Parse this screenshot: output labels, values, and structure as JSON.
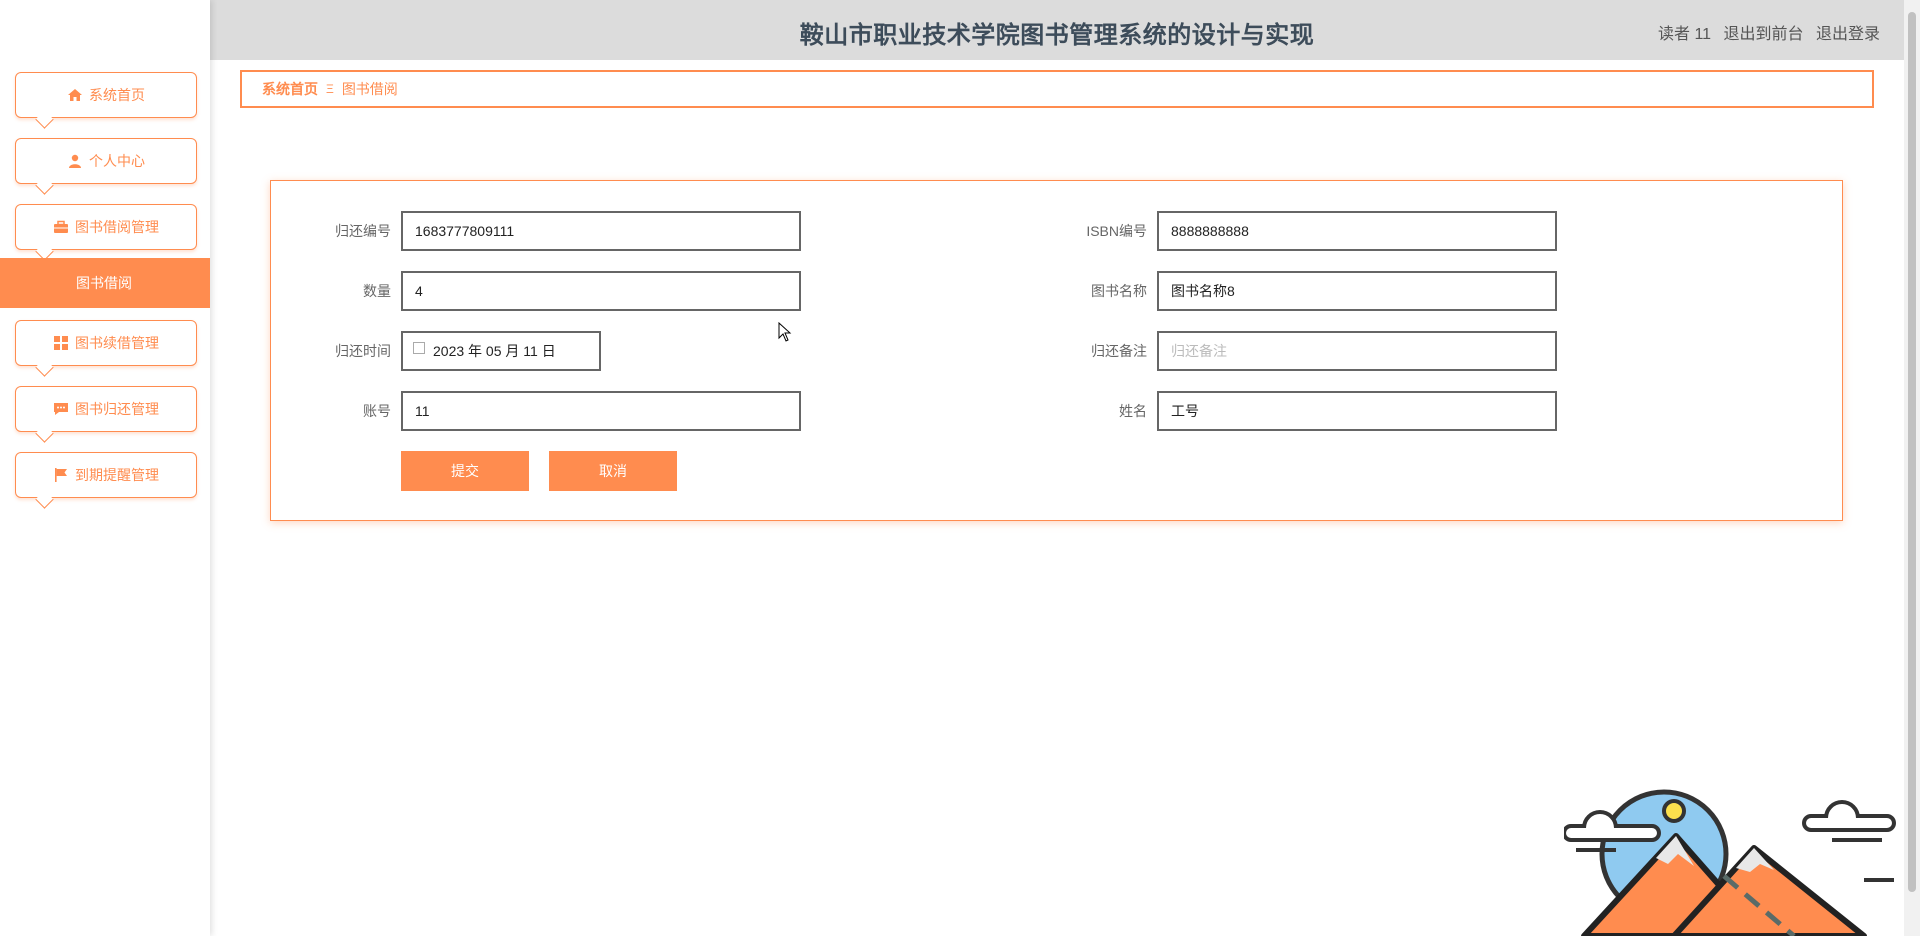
{
  "header": {
    "title": "鞍山市职业技术学院图书管理系统的设计与实现",
    "user": "读者 11",
    "back_to_front": "退出到前台",
    "logout": "退出登录"
  },
  "sidebar": {
    "items": [
      {
        "label": "系统首页",
        "icon": "home-icon"
      },
      {
        "label": "个人中心",
        "icon": "user-icon"
      },
      {
        "label": "图书借阅管理",
        "icon": "briefcase-icon"
      },
      {
        "label": "图书续借管理",
        "icon": "grid-icon"
      },
      {
        "label": "图书归还管理",
        "icon": "chat-icon"
      },
      {
        "label": "到期提醒管理",
        "icon": "flag-icon"
      }
    ],
    "submenu_active": "图书借阅"
  },
  "breadcrumb": {
    "home": "系统首页",
    "separator": "Ξ",
    "current": "图书借阅"
  },
  "form": {
    "return_no": {
      "label": "归还编号",
      "value": "1683777809111"
    },
    "isbn": {
      "label": "ISBN编号",
      "value": "8888888888"
    },
    "quantity": {
      "label": "数量",
      "value": "4"
    },
    "book_name": {
      "label": "图书名称",
      "value": "图书名称8"
    },
    "return_time": {
      "label": "归还时间",
      "value": "2023 年 05 月 11 日"
    },
    "return_note": {
      "label": "归还备注",
      "placeholder": "归还备注",
      "value": ""
    },
    "account": {
      "label": "账号",
      "value": "11"
    },
    "name": {
      "label": "姓名",
      "value": "工号"
    },
    "submit_label": "提交",
    "cancel_label": "取消"
  },
  "colors": {
    "accent": "#ff8c4f",
    "header_bg": "#dcdcdc",
    "title": "#3d4c5a"
  }
}
